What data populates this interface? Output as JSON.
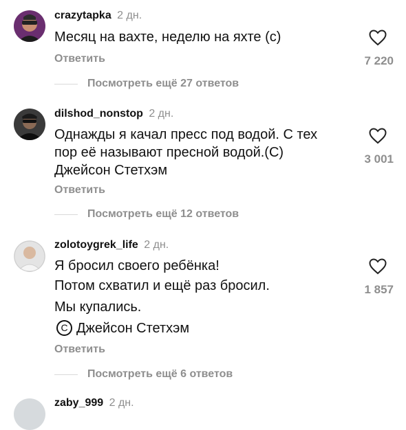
{
  "comments": [
    {
      "username": "crazytapka",
      "time": "2 дн.",
      "lines": [
        "Месяц на вахте, неделю на яхте (с)"
      ],
      "reply": "Ответить",
      "likes": "7 220",
      "more": "Посмотреть ещё 27 ответов"
    },
    {
      "username": "dilshod_nonstop",
      "time": "2 дн.",
      "lines": [
        "Однажды я качал пресс под водой. С тех",
        "пор её называют пресной водой.(С)",
        "Джейсон Стетхэм"
      ],
      "reply": "Ответить",
      "likes": "3 001",
      "more": "Посмотреть ещё 12 ответов"
    },
    {
      "username": "zolotoygrek_life",
      "time": "2 дн.",
      "lines": [
        "Я бросил своего ребёнка!",
        "Потом схватил и ещё раз бросил.",
        "Мы купались.",
        "Джейсон Стетхэм"
      ],
      "copyright_symbol": "C",
      "reply": "Ответить",
      "likes": "1 857",
      "more": "Посмотреть ещё 6 ответов"
    },
    {
      "username": "zaby_999",
      "time": "2 дн."
    }
  ],
  "icons": {
    "like": "heart-outline-icon"
  },
  "colors": {
    "secondary_text": "#8e8e8e",
    "primary_text": "#111111"
  }
}
